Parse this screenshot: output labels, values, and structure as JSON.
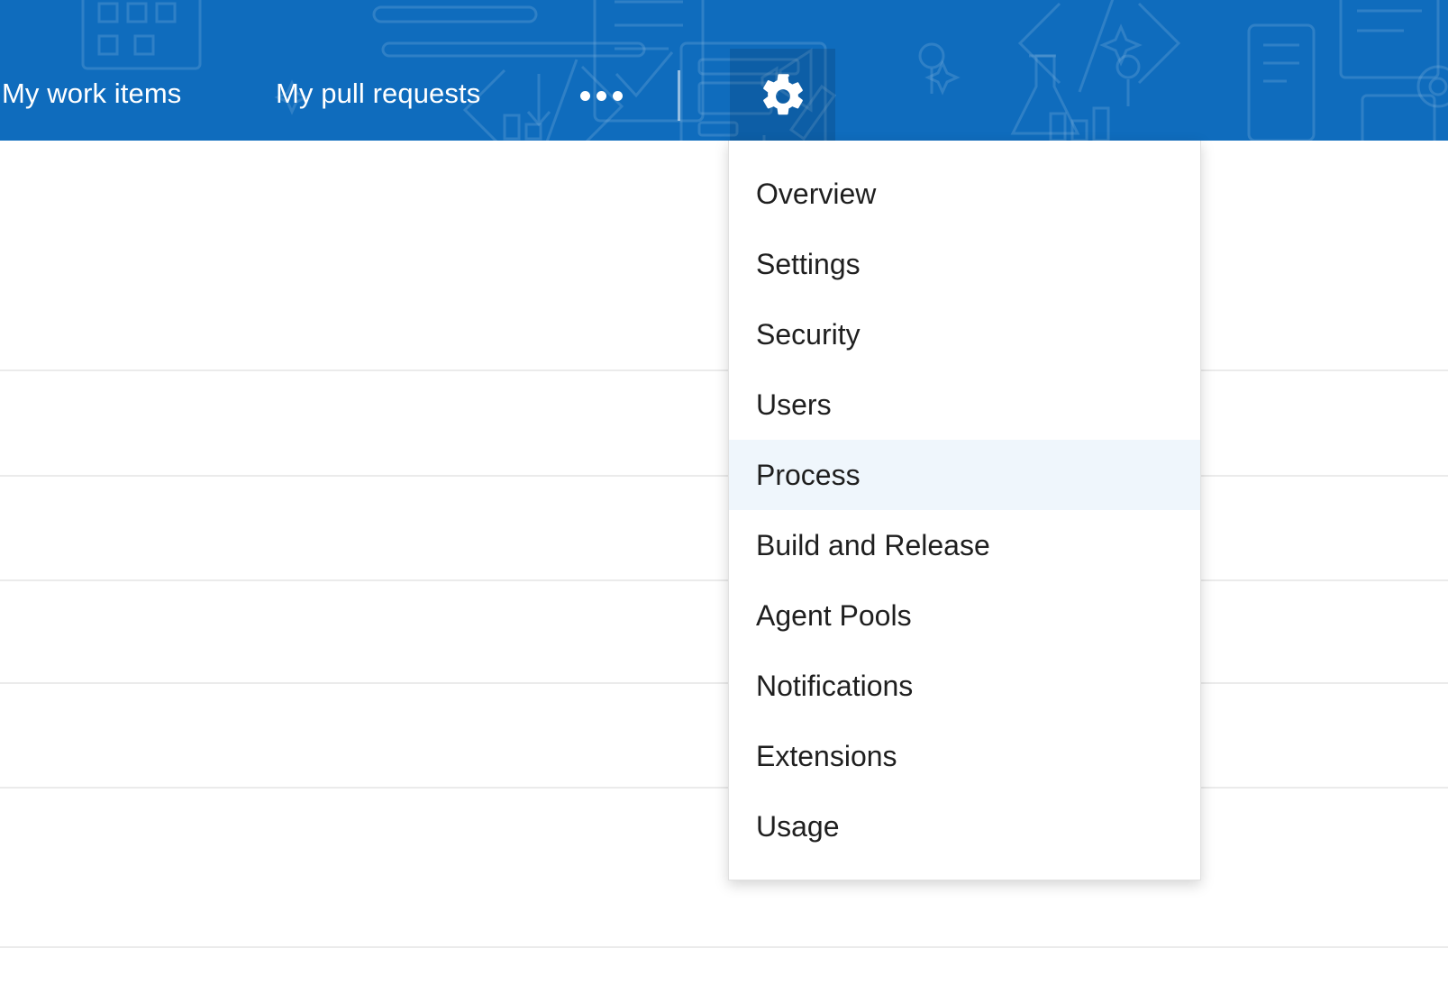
{
  "colors": {
    "header_blue": "#0f6cbd",
    "header_active": "#0a5ba6",
    "menu_highlight": "#eff6fc",
    "menu_text": "#1f1f1f",
    "row_divider": "#ebebeb"
  },
  "top_nav": {
    "links": [
      {
        "label": "My work items",
        "name": "nav-my-work-items"
      },
      {
        "label": "My pull requests",
        "name": "nav-my-pull-requests"
      }
    ],
    "overflow_label": "•••",
    "overflow_icon": "ellipsis-icon",
    "separator_icon": "vertical-separator",
    "settings_icon": "gear-icon",
    "settings_active": true
  },
  "settings_menu": {
    "open": true,
    "items": [
      {
        "label": "Overview",
        "selected": false
      },
      {
        "label": "Settings",
        "selected": false
      },
      {
        "label": "Security",
        "selected": false
      },
      {
        "label": "Users",
        "selected": false
      },
      {
        "label": "Process",
        "selected": true
      },
      {
        "label": "Build and Release",
        "selected": false
      },
      {
        "label": "Agent Pools",
        "selected": false
      },
      {
        "label": "Notifications",
        "selected": false
      },
      {
        "label": "Extensions",
        "selected": false
      },
      {
        "label": "Usage",
        "selected": false
      }
    ]
  },
  "background": {
    "divider_positions": [
      410,
      527,
      643,
      757,
      873,
      1050
    ]
  }
}
